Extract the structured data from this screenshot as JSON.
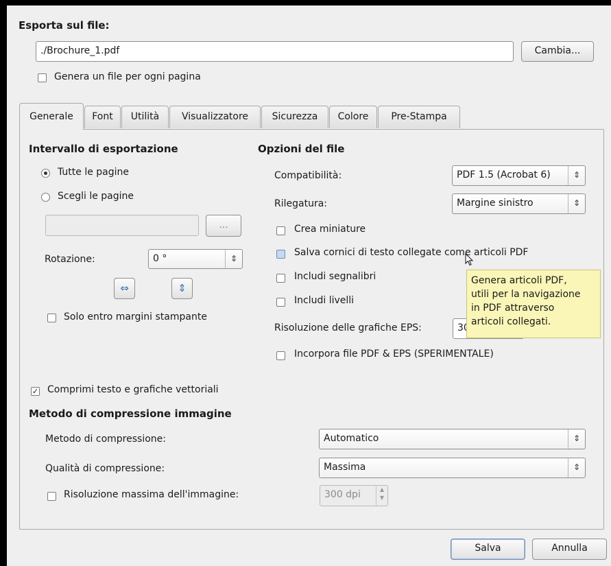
{
  "export": {
    "heading": "Esporta sul file:",
    "filepath": "./Brochure_1.pdf",
    "change_button": "Cambia...",
    "one_file_per_page": "Genera un file per ogni pagina"
  },
  "tabs": [
    {
      "label": "Generale",
      "active": true
    },
    {
      "label": "Font"
    },
    {
      "label": "Utilità"
    },
    {
      "label": "Visualizzatore"
    },
    {
      "label": "Sicurezza"
    },
    {
      "label": "Colore"
    },
    {
      "label": "Pre-Stampa"
    }
  ],
  "range": {
    "heading": "Intervallo di esportazione",
    "all_pages": "Tutte le pagine",
    "choose_pages": "Scegli le pagine",
    "pages_value": "",
    "browse_button": "...",
    "rotation_label": "Rotazione:",
    "rotation_value": "0 °",
    "within_margins": "Solo entro margini stampante"
  },
  "file_options": {
    "heading": "Opzioni del file",
    "compatibility_label": "Compatibilità:",
    "compatibility_value": "PDF 1.5 (Acrobat 6)",
    "binding_label": "Rilegatura:",
    "binding_value": "Margine sinistro",
    "thumbnails": "Crea miniature",
    "linked_frames": "Salva cornici di testo collegate come articoli PDF",
    "bookmarks": "Includi segnalibri",
    "layers": "Includi livelli",
    "eps_resolution_label": "Risoluzione delle grafiche EPS:",
    "eps_resolution_value": "30",
    "embed_pdf_eps": "Incorpora file PDF & EPS (SPERIMENTALE)"
  },
  "tooltip": {
    "lines": [
      "Genera articoli PDF,",
      "utili per la navigazione",
      "in PDF attraverso",
      "articoli collegati."
    ]
  },
  "compression": {
    "compress_text": "Comprimi testo e grafiche vettoriali",
    "heading": "Metodo di compressione immagine",
    "method_label": "Metodo di compressione:",
    "method_value": "Automatico",
    "quality_label": "Qualità di compressione:",
    "quality_value": "Massima",
    "max_res_label": "Risoluzione massima dell'immagine:",
    "max_res_value": "300 dpi"
  },
  "footer": {
    "save": "Salva",
    "cancel": "Annulla"
  }
}
